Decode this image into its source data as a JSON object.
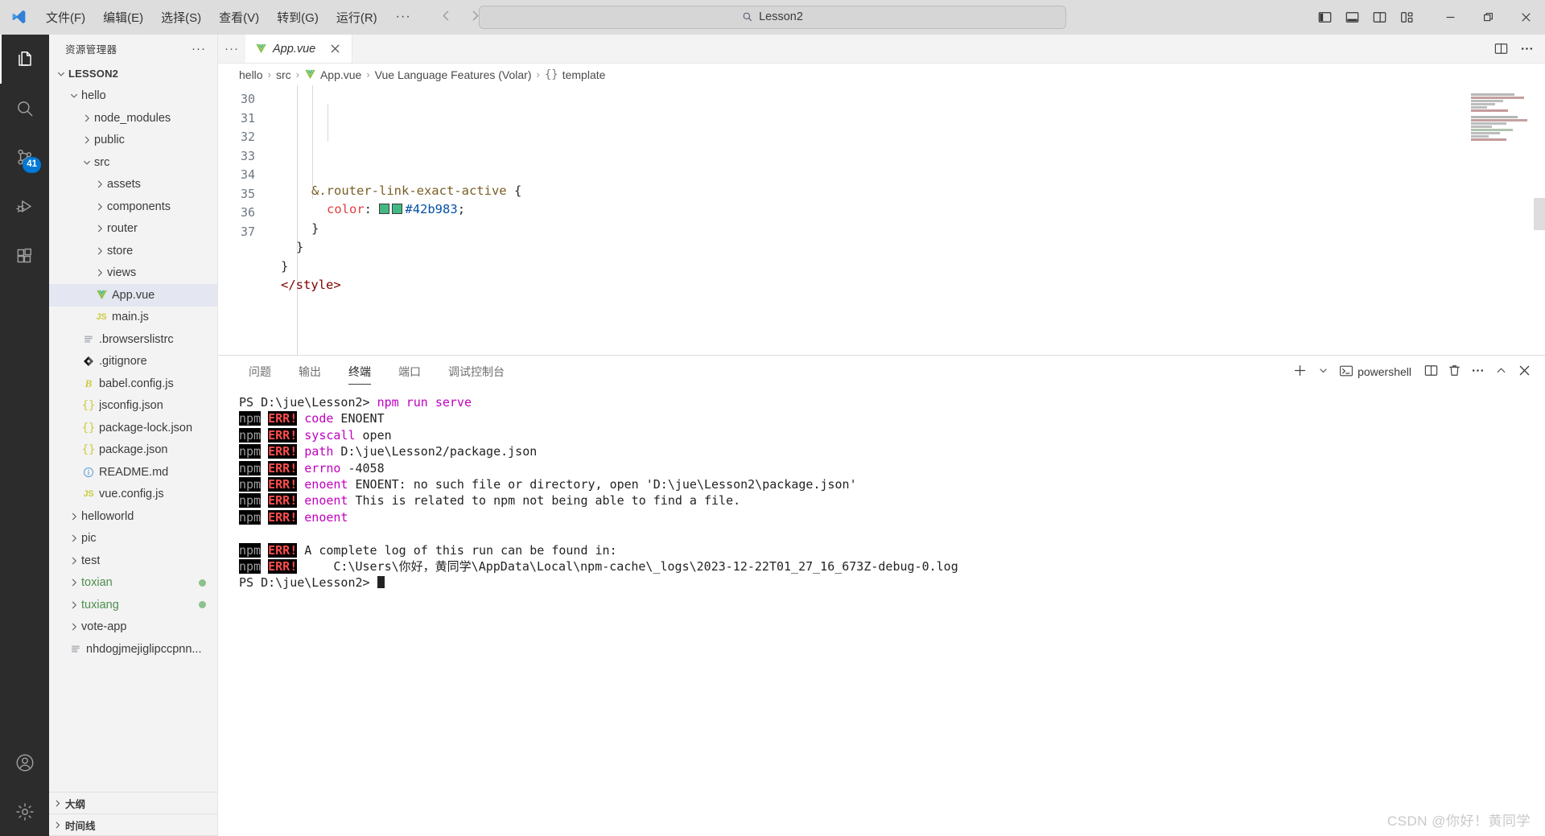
{
  "titlebar": {
    "logo_icon": "vscode-logo",
    "menus": [
      "文件(F)",
      "编辑(E)",
      "选择(S)",
      "查看(V)",
      "转到(G)",
      "运行(R)"
    ],
    "more_label": "···",
    "nav_back_icon": "arrow-left-icon",
    "nav_forward_icon": "arrow-right-icon",
    "command_center": {
      "icon": "search-icon",
      "text": "Lesson2"
    },
    "layout_buttons": [
      {
        "name": "toggle-primary-sidebar-button",
        "icon": "layout-sidebar-left-icon"
      },
      {
        "name": "toggle-panel-button",
        "icon": "layout-panel-icon"
      },
      {
        "name": "toggle-secondary-sidebar-button",
        "icon": "layout-sidebar-right-icon"
      },
      {
        "name": "customize-layout-button",
        "icon": "layout-customize-icon"
      }
    ],
    "window_controls": [
      {
        "name": "minimize-button",
        "icon": "minimize-icon"
      },
      {
        "name": "maximize-button",
        "icon": "restore-icon"
      },
      {
        "name": "close-button",
        "icon": "close-icon"
      }
    ]
  },
  "activitybar": {
    "items": [
      {
        "name": "activity-explorer",
        "icon": "files-icon",
        "active": true
      },
      {
        "name": "activity-search",
        "icon": "search-icon",
        "active": false
      },
      {
        "name": "activity-source-control",
        "icon": "source-control-icon",
        "active": false,
        "badge": "41"
      },
      {
        "name": "activity-run-debug",
        "icon": "run-debug-icon",
        "active": false
      },
      {
        "name": "activity-extensions",
        "icon": "extensions-icon",
        "active": false
      }
    ],
    "bottom_items": [
      {
        "name": "activity-accounts",
        "icon": "account-icon"
      },
      {
        "name": "activity-manage",
        "icon": "gear-icon"
      }
    ]
  },
  "sidebar": {
    "title": "资源管理器",
    "more_actions": "···",
    "tree": [
      {
        "label": "LESSON2",
        "depth": 0,
        "type": "root",
        "twisty": "down"
      },
      {
        "label": "hello",
        "depth": 1,
        "type": "folder",
        "twisty": "down"
      },
      {
        "label": "node_modules",
        "depth": 2,
        "type": "folder",
        "twisty": "right"
      },
      {
        "label": "public",
        "depth": 2,
        "type": "folder",
        "twisty": "right"
      },
      {
        "label": "src",
        "depth": 2,
        "type": "folder",
        "twisty": "down"
      },
      {
        "label": "assets",
        "depth": 3,
        "type": "folder",
        "twisty": "right"
      },
      {
        "label": "components",
        "depth": 3,
        "type": "folder",
        "twisty": "right"
      },
      {
        "label": "router",
        "depth": 3,
        "type": "folder",
        "twisty": "right"
      },
      {
        "label": "store",
        "depth": 3,
        "type": "folder",
        "twisty": "right"
      },
      {
        "label": "views",
        "depth": 3,
        "type": "folder",
        "twisty": "right"
      },
      {
        "label": "App.vue",
        "depth": 3,
        "type": "file",
        "icon": "vue-icon",
        "selected": true
      },
      {
        "label": "main.js",
        "depth": 3,
        "type": "file",
        "icon": "js-icon"
      },
      {
        "label": ".browserslistrc",
        "depth": 2,
        "type": "file",
        "icon": "config-lines-icon"
      },
      {
        "label": ".gitignore",
        "depth": 2,
        "type": "file",
        "icon": "git-icon"
      },
      {
        "label": "babel.config.js",
        "depth": 2,
        "type": "file",
        "icon": "babel-icon"
      },
      {
        "label": "jsconfig.json",
        "depth": 2,
        "type": "file",
        "icon": "json-icon"
      },
      {
        "label": "package-lock.json",
        "depth": 2,
        "type": "file",
        "icon": "json-icon"
      },
      {
        "label": "package.json",
        "depth": 2,
        "type": "file",
        "icon": "json-icon"
      },
      {
        "label": "README.md",
        "depth": 2,
        "type": "file",
        "icon": "info-icon"
      },
      {
        "label": "vue.config.js",
        "depth": 2,
        "type": "file",
        "icon": "js-icon"
      },
      {
        "label": "helloworld",
        "depth": 1,
        "type": "folder",
        "twisty": "right"
      },
      {
        "label": "pic",
        "depth": 1,
        "type": "folder",
        "twisty": "right"
      },
      {
        "label": "test",
        "depth": 1,
        "type": "folder",
        "twisty": "right"
      },
      {
        "label": "toxian",
        "depth": 1,
        "type": "folder",
        "twisty": "right",
        "git": "untracked",
        "dot": true
      },
      {
        "label": "tuxiang",
        "depth": 1,
        "type": "folder",
        "twisty": "right",
        "git": "untracked",
        "dot": true
      },
      {
        "label": "vote-app",
        "depth": 1,
        "type": "folder",
        "twisty": "right"
      },
      {
        "label": "nhdogjmejiglipccpnn...",
        "depth": 1,
        "type": "file",
        "icon": "config-lines-icon"
      }
    ],
    "sections": [
      {
        "label": "大纲",
        "twisty": "right"
      },
      {
        "label": "时间线",
        "twisty": "right"
      }
    ]
  },
  "editor": {
    "tabs_prefix": "···",
    "tabs": [
      {
        "label": "App.vue",
        "icon": "vue-icon",
        "preview": true,
        "close_icon": "close-icon"
      }
    ],
    "tab_actions": [
      {
        "name": "split-editor-right-button",
        "icon": "split-editor-icon"
      },
      {
        "name": "editor-more-actions-button",
        "icon": "ellipsis-icon"
      }
    ],
    "breadcrumbs": [
      {
        "label": "hello",
        "icon": null
      },
      {
        "label": "src",
        "icon": null
      },
      {
        "label": "App.vue",
        "icon": "vue-icon"
      },
      {
        "label": "Vue Language Features (Volar)",
        "icon": null
      },
      {
        "label": "template",
        "icon": "braces-icon"
      }
    ],
    "breadcrumb_separator": "›",
    "first_line_number": 30,
    "lines": [
      {
        "n": 30,
        "text": "",
        "html": ""
      },
      {
        "n": 31,
        "indent": 2,
        "html": "<span class=\"tok-sel\">&amp;.router-link-exact-active</span> <span class=\"tok-punct\">{</span>"
      },
      {
        "n": 32,
        "indent": 3,
        "html": "<span class=\"tok-prop\">color</span><span class=\"tok-punct\">:</span> <span class=\"sw1\"></span><span class=\"sw2\"></span><span class=\"tok-val\">#42b983</span><span class=\"tok-punct\">;</span>"
      },
      {
        "n": 33,
        "indent": 2,
        "html": "<span class=\"tok-punct\">}</span>"
      },
      {
        "n": 34,
        "indent": 1,
        "html": "<span class=\"tok-punct\">}</span>"
      },
      {
        "n": 35,
        "indent": 0,
        "html": "<span class=\"tok-punct\">}</span>"
      },
      {
        "n": 36,
        "indent": 0,
        "html": "<span class=\"tok-tag\">&lt;/style&gt;</span>"
      },
      {
        "n": 37,
        "indent": 0,
        "html": ""
      }
    ],
    "color_swatch": "#42b983",
    "language": "vue"
  },
  "panel": {
    "tabs": [
      {
        "label": "问题",
        "active": false
      },
      {
        "label": "输出",
        "active": false
      },
      {
        "label": "终端",
        "active": true
      },
      {
        "label": "端口",
        "active": false
      },
      {
        "label": "调试控制台",
        "active": false
      }
    ],
    "actions": {
      "new_terminal_icon": "plus-icon",
      "new_terminal_dropdown_icon": "chevron-down-icon",
      "shell_icon": "terminal-icon",
      "shell_label": "powershell",
      "split_icon": "split-terminal-icon",
      "kill_icon": "trash-icon",
      "more_icon": "ellipsis-icon",
      "maximize_icon": "chevron-up-icon",
      "close_icon": "close-icon"
    },
    "terminal": {
      "prompt": "PS D:\\jue\\Lesson2>",
      "command": "npm run serve",
      "npm_tag": "npm",
      "err_tag": "ERR!",
      "lines": [
        {
          "type": "cmd",
          "prompt": "PS D:\\jue\\Lesson2>",
          "cmd": " npm run serve"
        },
        {
          "type": "err",
          "key": "code",
          "rest": " ENOENT"
        },
        {
          "type": "err",
          "key": "syscall",
          "rest": " open"
        },
        {
          "type": "err",
          "key": "path",
          "rest": " D:\\jue\\Lesson2/package.json"
        },
        {
          "type": "err",
          "key": "errno",
          "rest": " -4058"
        },
        {
          "type": "err",
          "key": "enoent",
          "rest": " ENOENT: no such file or directory, open 'D:\\jue\\Lesson2\\package.json'"
        },
        {
          "type": "err",
          "key": "enoent",
          "rest": " This is related to npm not being able to find a file."
        },
        {
          "type": "err",
          "key": "enoent",
          "rest": ""
        },
        {
          "type": "blank"
        },
        {
          "type": "err",
          "key": "",
          "rest": "A complete log of this run can be found in:"
        },
        {
          "type": "err",
          "key": "",
          "rest": "    C:\\Users\\你好，黄同学\\AppData\\Local\\npm-cache\\_logs\\2023-12-22T01_27_16_673Z-debug-0.log"
        },
        {
          "type": "prompt_only",
          "prompt": "PS D:\\jue\\Lesson2>"
        }
      ]
    }
  },
  "watermark": "CSDN @你好！黄同学",
  "colors": {
    "titlebar_bg": "#dddddd",
    "activitybar_bg": "#2c2c2c",
    "sidebar_bg": "#f3f3f3",
    "editor_bg": "#ffffff",
    "accent_badge": "#0078d4",
    "selection": "#e4e6f1",
    "git_untracked": "#4d8f4d",
    "vue_green": "#42b983",
    "terminal_err": "#ff4d4d",
    "terminal_magenta": "#c000c0"
  }
}
